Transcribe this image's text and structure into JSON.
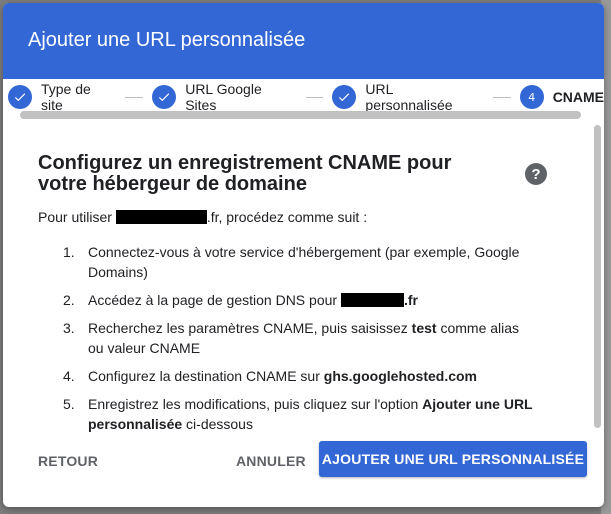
{
  "dialog": {
    "title": "Ajouter une URL personnalisée"
  },
  "stepper": {
    "steps": [
      {
        "label": "Type de site",
        "state": "done"
      },
      {
        "label": "URL Google Sites",
        "state": "done"
      },
      {
        "label": "URL personnalisée",
        "state": "done"
      },
      {
        "label": "CNAME",
        "state": "active",
        "number": "4"
      }
    ]
  },
  "content": {
    "title": "Configurez un enregistrement CNAME pour votre hébergeur de domaine",
    "intro_prefix": "Pour utiliser ",
    "intro_suffix": ".fr, procédez comme suit :",
    "steps": [
      {
        "num": "1.",
        "text": "Connectez-vous à votre service d'hébergement (par exemple, Google Domains)"
      },
      {
        "num": "2.",
        "text_prefix": "Accédez à la page de gestion DNS pour ",
        "text_suffix": ".fr"
      },
      {
        "num": "3.",
        "text_a": "Recherchez les paramètres CNAME, puis saisissez ",
        "bold": "test",
        "text_b": " comme alias ou valeur CNAME"
      },
      {
        "num": "4.",
        "text_a": "Configurez la destination CNAME sur ",
        "bold": "ghs.googlehosted.com"
      },
      {
        "num": "5.",
        "text_a": "Enregistrez les modifications, puis cliquez sur l'option ",
        "bold": "Ajouter une URL personnalisée",
        "text_b": " ci-dessous"
      }
    ]
  },
  "footer": {
    "back_label": "RETOUR",
    "cancel_label": "ANNULER",
    "primary_label": "AJOUTER UNE URL PERSONNALISÉE"
  },
  "icons": {
    "help": "help-icon",
    "check": "check-icon"
  },
  "colors": {
    "accent": "#3367d6",
    "backdrop": "#7d7d7d"
  }
}
